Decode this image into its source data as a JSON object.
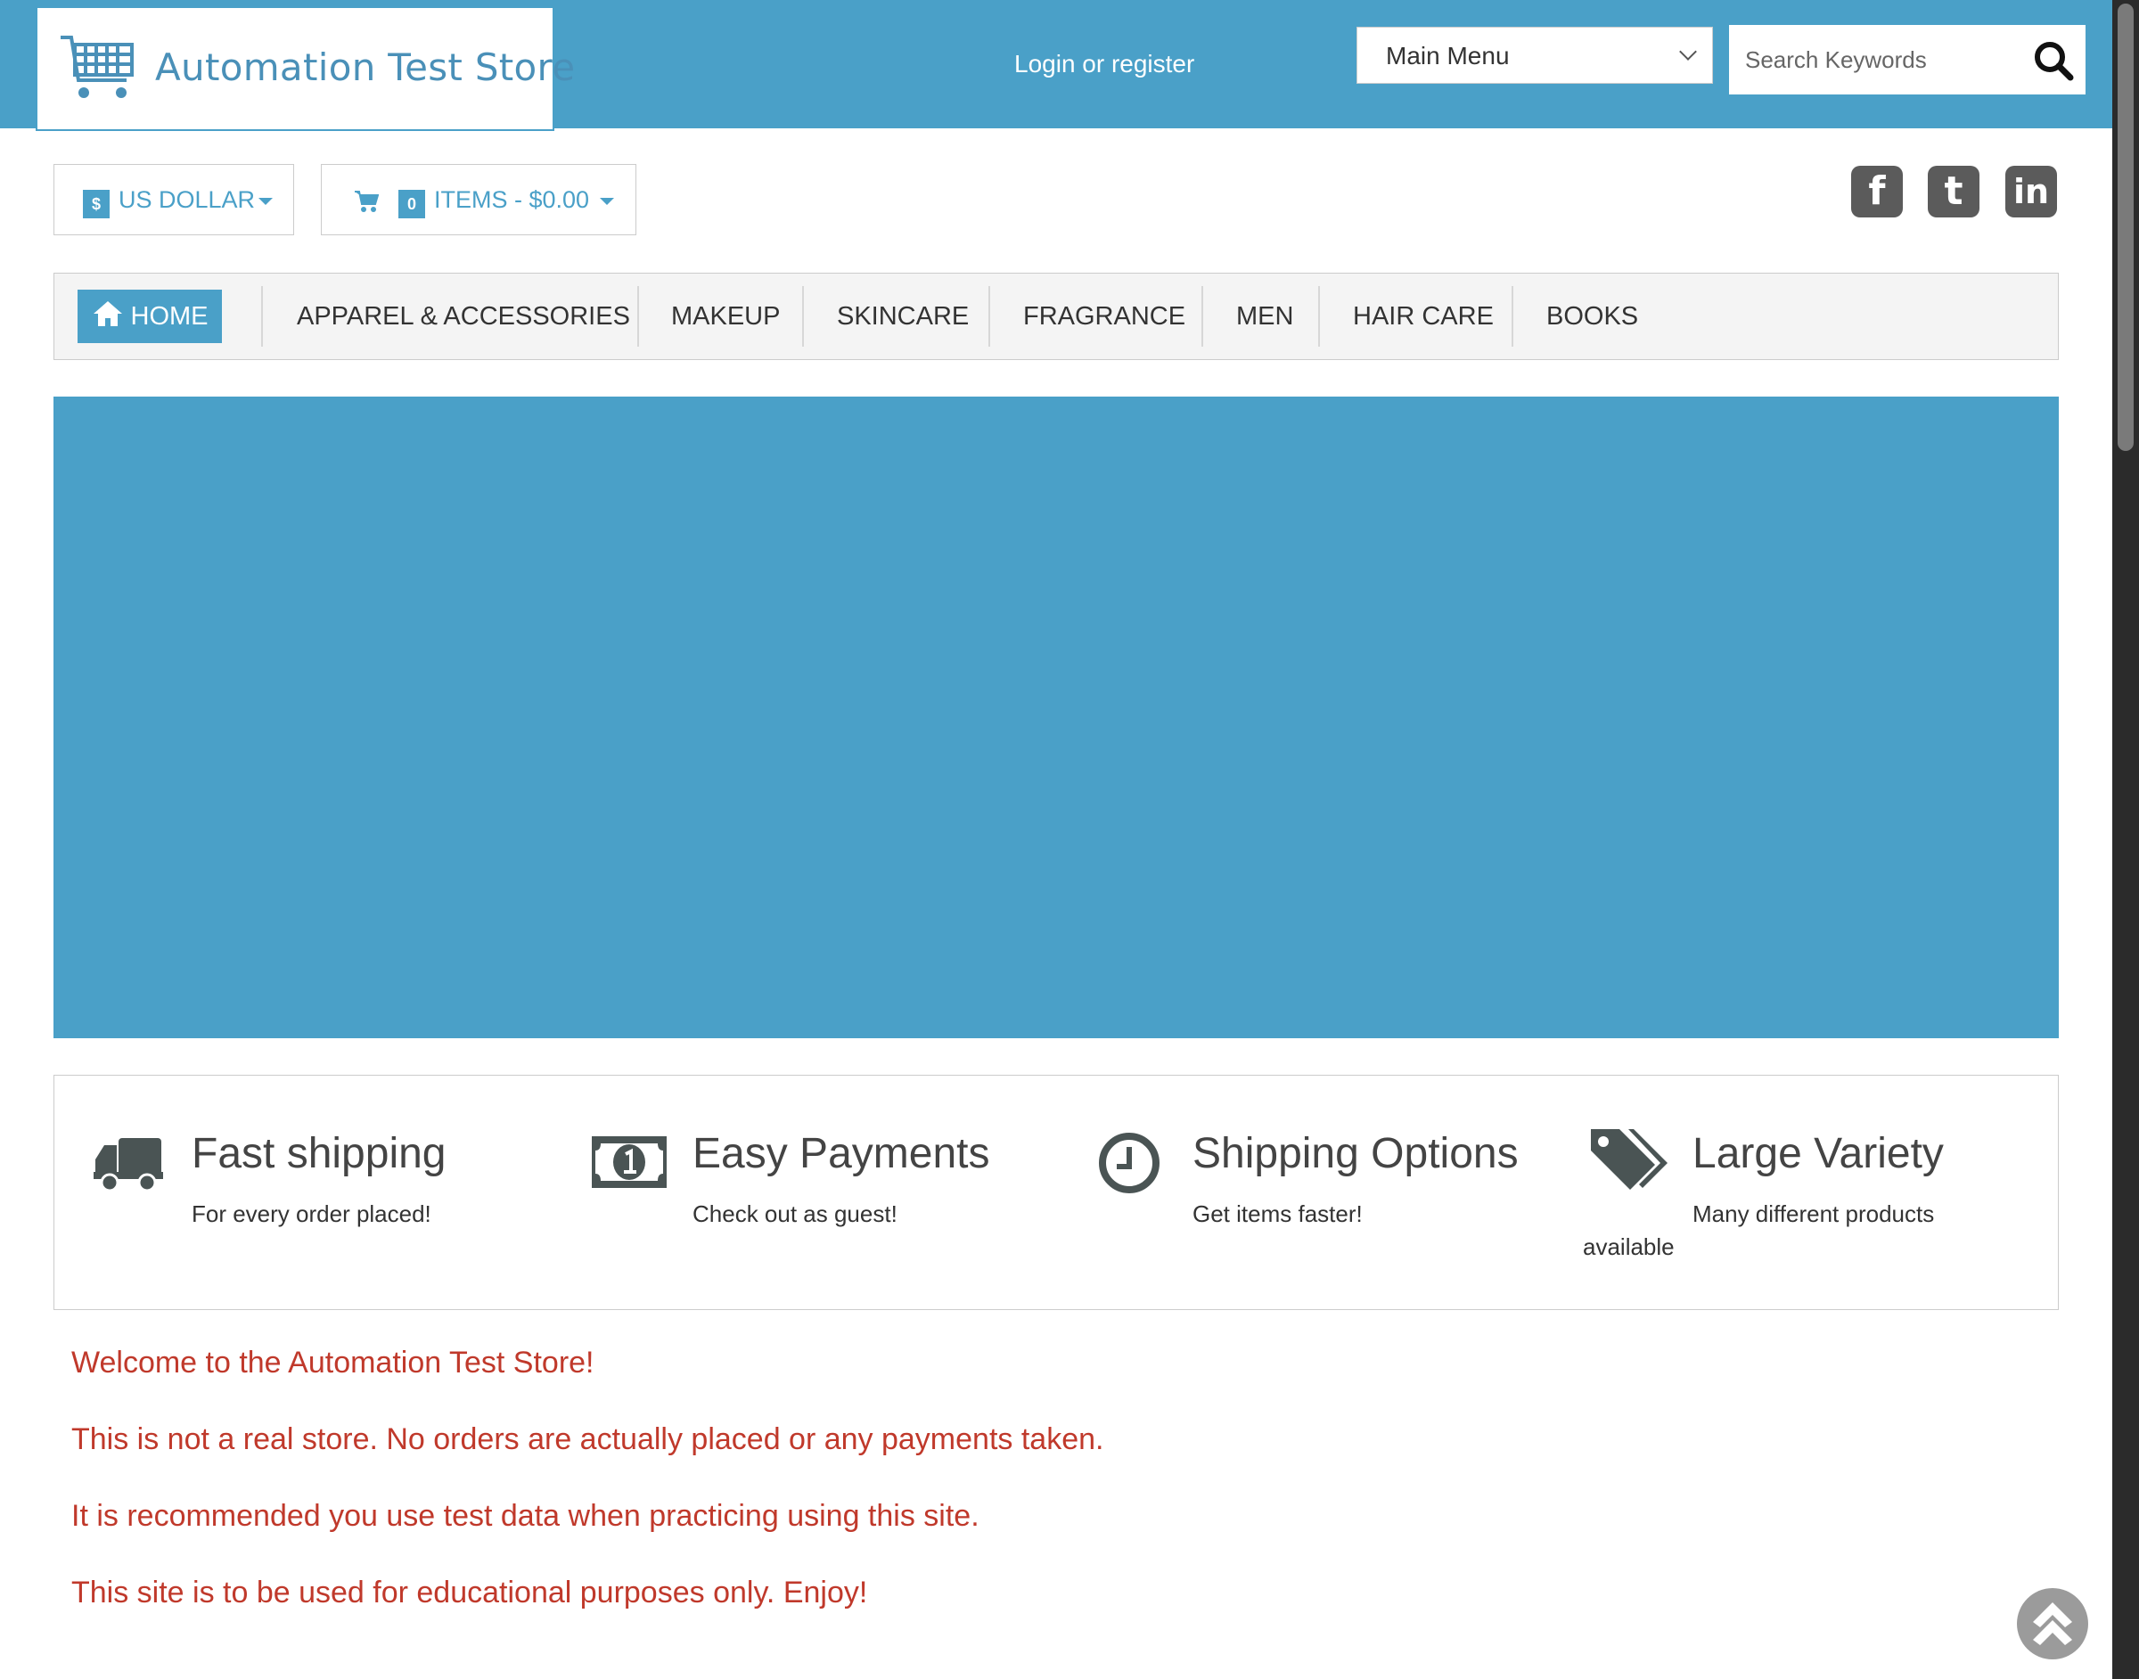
{
  "header": {
    "store_name": "Automation Test Store",
    "login_link": "Login or register",
    "main_menu_select": {
      "selected": "Main Menu"
    },
    "search": {
      "placeholder": "Search Keywords"
    }
  },
  "currency": {
    "symbol": "$",
    "label": "US DOLLAR"
  },
  "cart": {
    "count": "0",
    "label": "ITEMS - $0.00"
  },
  "social": {
    "facebook": "f",
    "twitter": "t",
    "linkedin": "in"
  },
  "nav": {
    "items": [
      {
        "label": "HOME"
      },
      {
        "label": "APPAREL & ACCESSORIES"
      },
      {
        "label": "MAKEUP"
      },
      {
        "label": "SKINCARE"
      },
      {
        "label": "FRAGRANCE"
      },
      {
        "label": "MEN"
      },
      {
        "label": "HAIR CARE"
      },
      {
        "label": "BOOKS"
      }
    ]
  },
  "features": [
    {
      "title": "Fast shipping",
      "subtitle": "For every order placed!"
    },
    {
      "title": "Easy Payments",
      "subtitle": "Check out as guest!"
    },
    {
      "title": "Shipping Options",
      "subtitle": "Get items faster!"
    },
    {
      "title": "Large Variety",
      "subtitle": "Many different products",
      "subtitle_wrap": "available"
    }
  ],
  "welcome": {
    "lines": [
      "Welcome to the Automation Test Store!",
      "This is not a real store. No orders are actually placed or any payments taken.",
      "It is recommended you use test data when practicing using this site.",
      "This site is to be used for educational purposes only. Enjoy!"
    ]
  },
  "colors": {
    "brand": "#4aa0c8",
    "notice": "#c0392b",
    "icon_gray": "#4a5454"
  }
}
